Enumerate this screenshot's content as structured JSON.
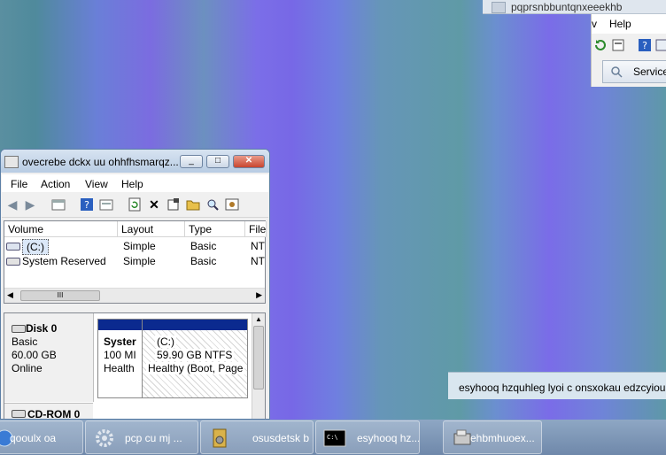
{
  "top_right_window": {
    "title": "pqprsnbbuntqnxeeekhb",
    "menu": [
      "v",
      "Help"
    ],
    "services_label": "Service"
  },
  "disk_window": {
    "title": "ovecrebe dckx uu ohhfhsmarqz...",
    "controls": {
      "minimize": "_",
      "maximize": "□",
      "close": "✕"
    },
    "menu": [
      "File",
      "Action",
      "View",
      "Help"
    ],
    "columns": [
      "Volume",
      "Layout",
      "Type",
      "File"
    ],
    "rows": [
      {
        "volume": "(C:)",
        "layout": "Simple",
        "type": "Basic",
        "file": "NT"
      },
      {
        "volume": "System Reserved",
        "layout": "Simple",
        "type": "Basic",
        "file": "NT"
      }
    ],
    "scroll_grip": "III",
    "disk0": {
      "name": "Disk 0",
      "kind": "Basic",
      "size": "60.00 GB",
      "status": "Online"
    },
    "partitions": {
      "sys": {
        "name": "Syster",
        "size": "100 MI",
        "status": "Health"
      },
      "c": {
        "name": "(C:)",
        "size": "59.90 GB NTFS",
        "status": "Healthy (Boot, Page"
      }
    },
    "cdrom": "CD-ROM 0"
  },
  "notification": "esyhooq hzquhleg  lyoi c onsxokau edzcyiou",
  "taskbar": [
    {
      "label": "qooulx  oa",
      "icon": "globe-icon"
    },
    {
      "label": "pcp    cu mj ...",
      "icon": "gear-icon"
    },
    {
      "label": "osusdetsk b ...",
      "icon": "archive-icon"
    },
    {
      "label": "esyhooq hz...",
      "icon": "terminal-icon"
    },
    {
      "label": "ehbmhuoex...",
      "icon": "drive-icon"
    }
  ]
}
